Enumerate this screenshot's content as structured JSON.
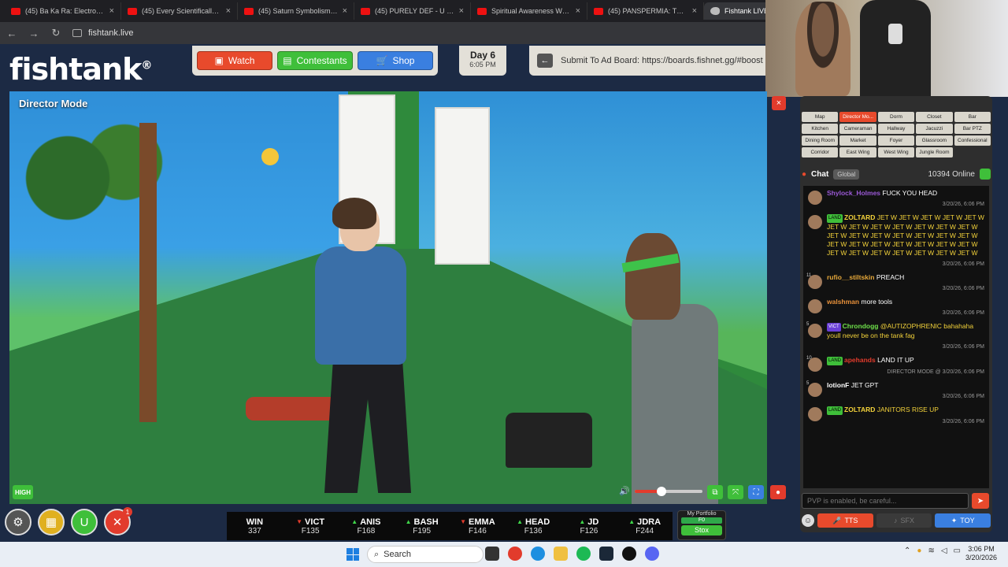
{
  "browser": {
    "tabs": [
      {
        "label": "(45) Ba Ka Ra: Electromagnet"
      },
      {
        "label": "(45) Every Scientifically Prov"
      },
      {
        "label": "(45) Saturn Symbolism Deep"
      },
      {
        "label": "(45) PURELY DEF - U MAD B"
      },
      {
        "label": "Spiritual Awareness Will Rui"
      },
      {
        "label": "(45) PANSPERMIA: The Radi"
      },
      {
        "label": "Fishtank LIVE"
      }
    ],
    "url": "fishtank.live"
  },
  "header": {
    "logo": "fishtank",
    "logo_mark": "®",
    "nav": {
      "watch": "Watch",
      "contestants": "Contestants",
      "shop": "Shop"
    },
    "day": "Day 6",
    "time": "6:05 PM",
    "adboard": "Submit To Ad Board: https://boards.fishnet.gg/#boost"
  },
  "video": {
    "mode_label": "Director Mode",
    "close": "×",
    "quality": "HIGH",
    "volume_level": 0.4
  },
  "rooms": [
    "Map",
    "Director Mo...",
    "Dorm",
    "Closet",
    "Bar",
    "Kitchen",
    "Cameraman",
    "Hallway",
    "Jacuzzi",
    "Bar PTZ",
    "Dining Room",
    "Market",
    "Foyer",
    "Glassroom",
    "Confessional",
    "Corridor",
    "East Wing",
    "West Wing",
    "Jungle Room"
  ],
  "selected_room": "Director Mo...",
  "chat": {
    "title": "Chat",
    "tab": "Global",
    "online": "10394 Online",
    "messages": [
      {
        "user": "Shylock_Holmes",
        "user_color": "#9b59d6",
        "text": "FUCK YOU HEAD",
        "text_color": "#ffffff",
        "time": "3/20/26, 6:06 PM",
        "tag": "",
        "level": ""
      },
      {
        "user": "ZOLTARD",
        "user_color": "#f3d23a",
        "text": "JET W JET W JET W JET W JET W JET W JET W JET W JET W JET W JET W JET W JET W JET W JET W JET W JET W JET W JET W JET W JET W JET W JET W JET W JET W JET W JET W JET W JET W JET W JET W JET W JET W",
        "text_color": "#f3d23a",
        "time": "3/20/26, 6:06 PM",
        "tag": "LAND",
        "level": ""
      },
      {
        "user": "rufio__stiltskin",
        "user_color": "#e8a93a",
        "text": "PREACH",
        "text_color": "#ffffff",
        "time": "3/20/26, 6:06 PM",
        "tag": "",
        "level": "11"
      },
      {
        "user": "walshman",
        "user_color": "#e8913a",
        "text": "more tools",
        "text_color": "#ffffff",
        "time": "3/20/26, 6:06 PM",
        "tag": "",
        "level": ""
      },
      {
        "user": "Chrondogg",
        "user_color": "#6ee04a",
        "text": "@AUTIZOPHRENIC bahahaha youll never be on the tank fag",
        "text_color": "#f3d23a",
        "time": "3/20/26, 6:06 PM",
        "tag": "VICT",
        "level": "5"
      },
      {
        "user": "apehands",
        "user_color": "#e23b2c",
        "text": "LAND IT UP",
        "text_color": "#ffffff",
        "time": "DIRECTOR MODE @ 3/20/26, 6:06 PM",
        "tag": "LAND",
        "level": "10"
      },
      {
        "user": "lotionF",
        "user_color": "#ffffff",
        "text": "JET GPT",
        "text_color": "#ffffff",
        "time": "3/20/26, 6:06 PM",
        "tag": "",
        "level": "5"
      },
      {
        "user": "ZOLTARD",
        "user_color": "#f3d23a",
        "text": "JANITORS RISE UP",
        "text_color": "#f3d23a",
        "time": "3/20/26, 6:06 PM",
        "tag": "LAND",
        "level": ""
      }
    ],
    "input_placeholder": "PVP is enabled, be careful...",
    "buttons": {
      "tts": "TTS",
      "sfx": "SFX",
      "toy": "TOY"
    }
  },
  "ticker": [
    {
      "name": "WIN",
      "dir": "",
      "price": "337"
    },
    {
      "name": "VICT",
      "dir": "down",
      "price": "F135"
    },
    {
      "name": "ANIS",
      "dir": "up",
      "price": "F168"
    },
    {
      "name": "BASH",
      "dir": "up",
      "price": "F195"
    },
    {
      "name": "EMMA",
      "dir": "down",
      "price": "F146"
    },
    {
      "name": "HEAD",
      "dir": "up",
      "price": "F136"
    },
    {
      "name": "JD",
      "dir": "up",
      "price": "F126"
    },
    {
      "name": "JDRA",
      "dir": "up",
      "price": "F244"
    }
  ],
  "portfolio": {
    "label": "My Portfolio",
    "value": "F0",
    "button": "Stox"
  },
  "bottom_badge": "1",
  "taskbar": {
    "search": "Search",
    "time": "3:06 PM",
    "date": "3/20/2026"
  },
  "colors": {
    "accent_red": "#e84a2c",
    "accent_green": "#3fbf3a",
    "accent_blue": "#3a7fe0",
    "background": "#1c2a44"
  }
}
